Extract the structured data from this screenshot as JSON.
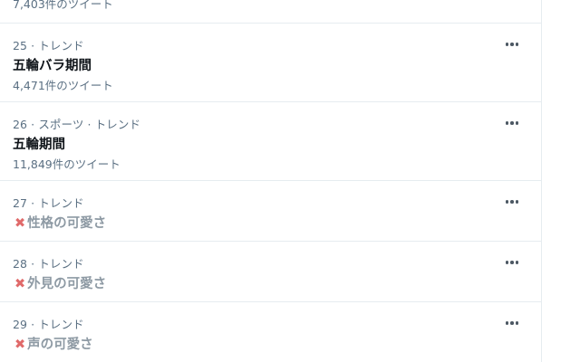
{
  "trends": [
    {
      "id": "prev",
      "tweet_count": "7,403件のツイート"
    },
    {
      "id": "t25",
      "meta": "25 · トレンド",
      "name": "五輪バラ期間",
      "tweet_count": "4,471件のツイート",
      "crossed": false
    },
    {
      "id": "t26",
      "meta": "26 · スポーツ · トレンド",
      "name": "五輪期間",
      "tweet_count": "11,849件のツイート",
      "crossed": false
    },
    {
      "id": "t27",
      "meta": "27 · トレンド",
      "name": "性格の可愛さ",
      "crossed": true
    },
    {
      "id": "t28",
      "meta": "28 · トレンド",
      "name": "外見の可愛さ",
      "crossed": true
    },
    {
      "id": "t29",
      "meta": "29 · トレンド",
      "name": "声の可愛さ",
      "crossed": true
    }
  ],
  "icons": {
    "more": "more-horizontal-icon",
    "cross": "cross-mark-icon"
  },
  "colors": {
    "cross_mark": "#e06a6a",
    "muted_title": "#8e9aa4",
    "meta_text": "#5b7083",
    "divider": "#e6ecf0"
  }
}
